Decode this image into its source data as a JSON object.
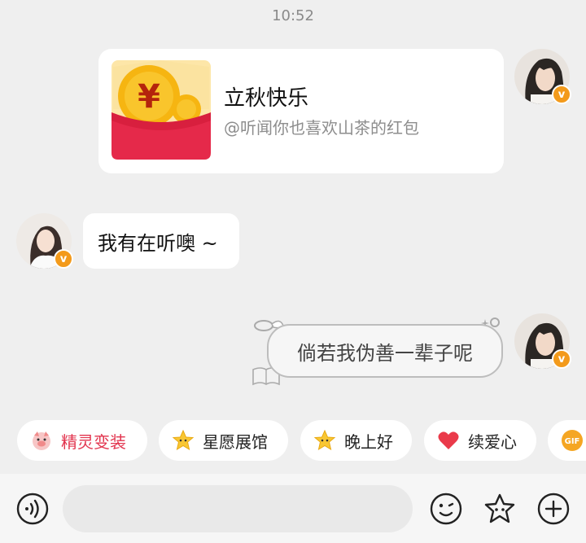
{
  "timestamp": "10:52",
  "messages": {
    "red_packet": {
      "title": "立秋快乐",
      "subtitle": "@听闻你也喜欢山茶的红包"
    },
    "incoming_text": "我有在听噢 ~",
    "outgoing_text": "倘若我伪善一辈子呢",
    "badge": "v"
  },
  "chips": [
    {
      "label": "精灵变装",
      "icon": "pig-face-icon"
    },
    {
      "label": "星愿展馆",
      "icon": "star-face-icon"
    },
    {
      "label": "晚上好",
      "icon": "star-face-icon"
    },
    {
      "label": "续爱心",
      "icon": "heart-icon"
    },
    {
      "label": "GIF",
      "icon": "gif-icon"
    }
  ],
  "colors": {
    "background": "#efefef",
    "chip_red": "#e2344e",
    "badge_orange": "#f39a1b",
    "red_packet": "#e5294a"
  },
  "input": {
    "placeholder": ""
  }
}
